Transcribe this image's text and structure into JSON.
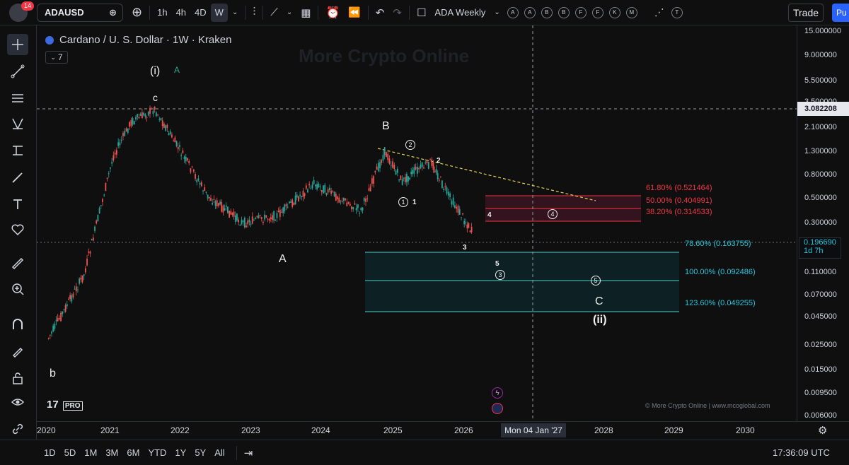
{
  "toolbar": {
    "notification_count": "14",
    "symbol": "ADAUSD",
    "timeframes": [
      "1h",
      "4h",
      "4D",
      "W"
    ],
    "active_timeframe": "W",
    "layout_name": "ADA Weekly",
    "alert_letters": [
      "A",
      "A",
      "B",
      "B",
      "F",
      "F",
      "K",
      "M"
    ],
    "t_label": "T",
    "trade_label": "Trade",
    "publish_label": "Pu"
  },
  "legend": {
    "title": "Cardano / U. S. Dollar · 1W · Kraken",
    "collapse_count": "7"
  },
  "watermark": {
    "text": "More Crypto Online"
  },
  "price_axis": {
    "labels": [
      "15.000000",
      "9.000000",
      "5.500000",
      "3.500000",
      "2.100000",
      "1.300000",
      "0.800000",
      "0.500000",
      "0.300000",
      "0.110000",
      "0.070000",
      "0.045000",
      "0.025000",
      "0.015000",
      "0.009500",
      "0.006000"
    ],
    "crosshair_price": "3.082208",
    "current_price": "0.196690",
    "countdown": "1d 7h"
  },
  "time_axis": {
    "labels": [
      "2020",
      "2021",
      "2022",
      "2023",
      "2024",
      "2025",
      "2026",
      "2028",
      "2029",
      "2030"
    ],
    "crosshair_date": "Mon 04 Jan '27"
  },
  "waves": {
    "i": "(i)",
    "a_green": "A",
    "c_top": "c",
    "b_low": "b",
    "A": "A",
    "B": "B",
    "C": "C",
    "ii": "(ii)",
    "c1": "1",
    "n1": "1",
    "c2": "2",
    "n2": "2",
    "n3": "3",
    "c3": "3",
    "n4": "4",
    "c4": "4",
    "n5": "5",
    "c5": "5"
  },
  "fib_levels": [
    {
      "label": "61.80% (0.521464)",
      "color": "#f23645"
    },
    {
      "label": "50.00% (0.404991)",
      "color": "#f23645"
    },
    {
      "label": "38.20% (0.314533)",
      "color": "#f23645"
    },
    {
      "label": "78.60% (0.163755)",
      "color": "#26c6da"
    },
    {
      "label": "100.00% (0.092486)",
      "color": "#26c6da"
    },
    {
      "label": "123.60% (0.049255)",
      "color": "#26c6da"
    }
  ],
  "branding": {
    "tv": "17",
    "pro": "PRO",
    "credit": "© More Crypto Online  |  www.mcoglobal.com"
  },
  "bottom": {
    "ranges": [
      "1D",
      "5D",
      "1M",
      "3M",
      "6M",
      "YTD",
      "1Y",
      "5Y",
      "All"
    ],
    "clock": "17:36:09 UTC"
  },
  "chart_data": {
    "type": "candlestick",
    "symbol": "ADAUSD",
    "timeframe": "1W",
    "exchange": "Kraken",
    "y_scale": "log",
    "ylim": [
      0.006,
      15.0
    ],
    "x_range": [
      "2020",
      "2030"
    ],
    "approx_path": [
      {
        "date": "2020-03",
        "price": 0.02
      },
      {
        "date": "2020-09",
        "price": 0.08
      },
      {
        "date": "2021-02",
        "price": 1.1
      },
      {
        "date": "2021-05",
        "price": 2.3
      },
      {
        "date": "2021-09",
        "price": 3.08
      },
      {
        "date": "2022-06",
        "price": 0.45
      },
      {
        "date": "2022-12",
        "price": 0.25
      },
      {
        "date": "2023-06",
        "price": 0.3
      },
      {
        "date": "2023-12",
        "price": 0.6
      },
      {
        "date": "2024-08",
        "price": 0.33
      },
      {
        "date": "2024-12",
        "price": 1.2
      },
      {
        "date": "2025-03",
        "price": 0.62
      },
      {
        "date": "2025-05",
        "price": 0.78
      },
      {
        "date": "2025-08",
        "price": 0.95
      },
      {
        "date": "2025-10",
        "price": 0.55
      },
      {
        "date": "2026-01",
        "price": 0.3
      },
      {
        "date": "2026-03",
        "price": 0.2
      }
    ]
  }
}
